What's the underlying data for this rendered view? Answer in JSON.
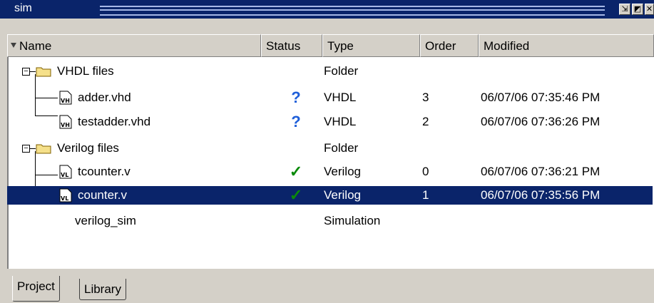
{
  "window": {
    "title": "sim",
    "buttons": [
      "undock-icon",
      "maximize-icon",
      "close-icon"
    ]
  },
  "columns": [
    {
      "key": "name",
      "label": "Name"
    },
    {
      "key": "status",
      "label": "Status"
    },
    {
      "key": "type",
      "label": "Type"
    },
    {
      "key": "order",
      "label": "Order"
    },
    {
      "key": "modified",
      "label": "Modified"
    }
  ],
  "rows": [
    {
      "name": "VHDL files",
      "kind": "folder",
      "status": "",
      "type": "Folder",
      "order": "",
      "modified": "",
      "selected": false
    },
    {
      "name": "adder.vhd",
      "kind": "vhdl-file",
      "icon_label": "VH",
      "status": "unknown",
      "type": "VHDL",
      "order": "3",
      "modified": "06/07/06 07:35:46 PM",
      "selected": false
    },
    {
      "name": "testadder.vhd",
      "kind": "vhdl-file",
      "icon_label": "VH",
      "status": "unknown",
      "type": "VHDL",
      "order": "2",
      "modified": "06/07/06 07:36:26 PM",
      "selected": false
    },
    {
      "name": "Verilog files",
      "kind": "folder",
      "status": "",
      "type": "Folder",
      "order": "",
      "modified": "",
      "selected": false
    },
    {
      "name": "tcounter.v",
      "kind": "verilog-file",
      "icon_label": "VL",
      "status": "compiled",
      "type": "Verilog",
      "order": "0",
      "modified": "06/07/06 07:36:21 PM",
      "selected": false
    },
    {
      "name": "counter.v",
      "kind": "verilog-file",
      "icon_label": "VL",
      "status": "compiled",
      "type": "Verilog",
      "order": "1",
      "modified": "06/07/06 07:35:56 PM",
      "selected": true
    },
    {
      "name": "verilog_sim",
      "kind": "simulation",
      "status": "",
      "type": "Simulation",
      "order": "",
      "modified": "",
      "selected": false
    }
  ],
  "status_glyphs": {
    "unknown": "?",
    "compiled": "✓"
  },
  "tabs": [
    {
      "label": "Project",
      "active": true
    },
    {
      "label": "Library",
      "active": false
    }
  ],
  "colors": {
    "title_bar": "#0a246a",
    "selection": "#0a246a",
    "unknown_status": "#1f5fd9",
    "compiled_status": "#0a8a0a",
    "folder": "#f5e08a"
  }
}
